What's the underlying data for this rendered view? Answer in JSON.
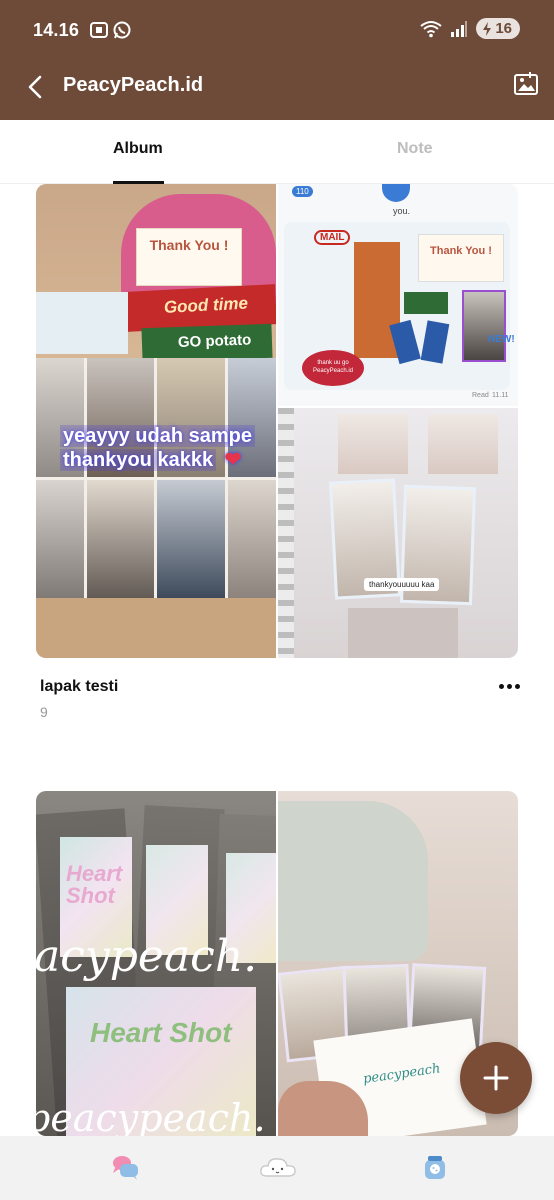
{
  "status_bar": {
    "time": "14.16",
    "battery_level": "16",
    "icons": [
      "screenshot-icon",
      "whatsapp-icon",
      "wifi-icon",
      "signal-icon",
      "battery-icon"
    ]
  },
  "header": {
    "title": "PeacyPeach.id",
    "back_icon": "chevron-left-icon",
    "action_icon": "gallery-icon",
    "background": "#6e4a39"
  },
  "tabs": [
    {
      "label": "Album",
      "active": true
    },
    {
      "label": "Note",
      "active": false
    }
  ],
  "albums": [
    {
      "name": "lapak testi",
      "count": "9",
      "photo_captions": {
        "thank_card": "Thank You !",
        "snack_label": "Good time",
        "chips_label": "GO potato",
        "overlay_line1": "yeayyy udah sampe",
        "overlay_line2": "thankyou kakkk",
        "chat_back_count": "110",
        "chat_name": "you.",
        "chat_mail_label": "MAIL",
        "chat_note": "thank uu go PeacyPeach.id",
        "chat_read": "Read",
        "chat_time": "11.11",
        "new_badge": "NEW!",
        "binder_sticker": "thankyouuuuu kaa"
      }
    },
    {
      "name": "",
      "count": "",
      "photo_captions": {
        "watermark_1": "acypeach.",
        "watermark_2": "peacypeach.",
        "heart_shot_1": "Heart Shot",
        "heart_shot_2": "Heart Shot",
        "envelope_text": "peacypeach"
      }
    }
  ],
  "fab": {
    "icon": "plus-icon",
    "color": "#7b4d37"
  },
  "bottom_nav": [
    {
      "icon": "chat-bubbles-icon"
    },
    {
      "icon": "cloud-icon"
    },
    {
      "icon": "cookie-jar-icon"
    }
  ]
}
